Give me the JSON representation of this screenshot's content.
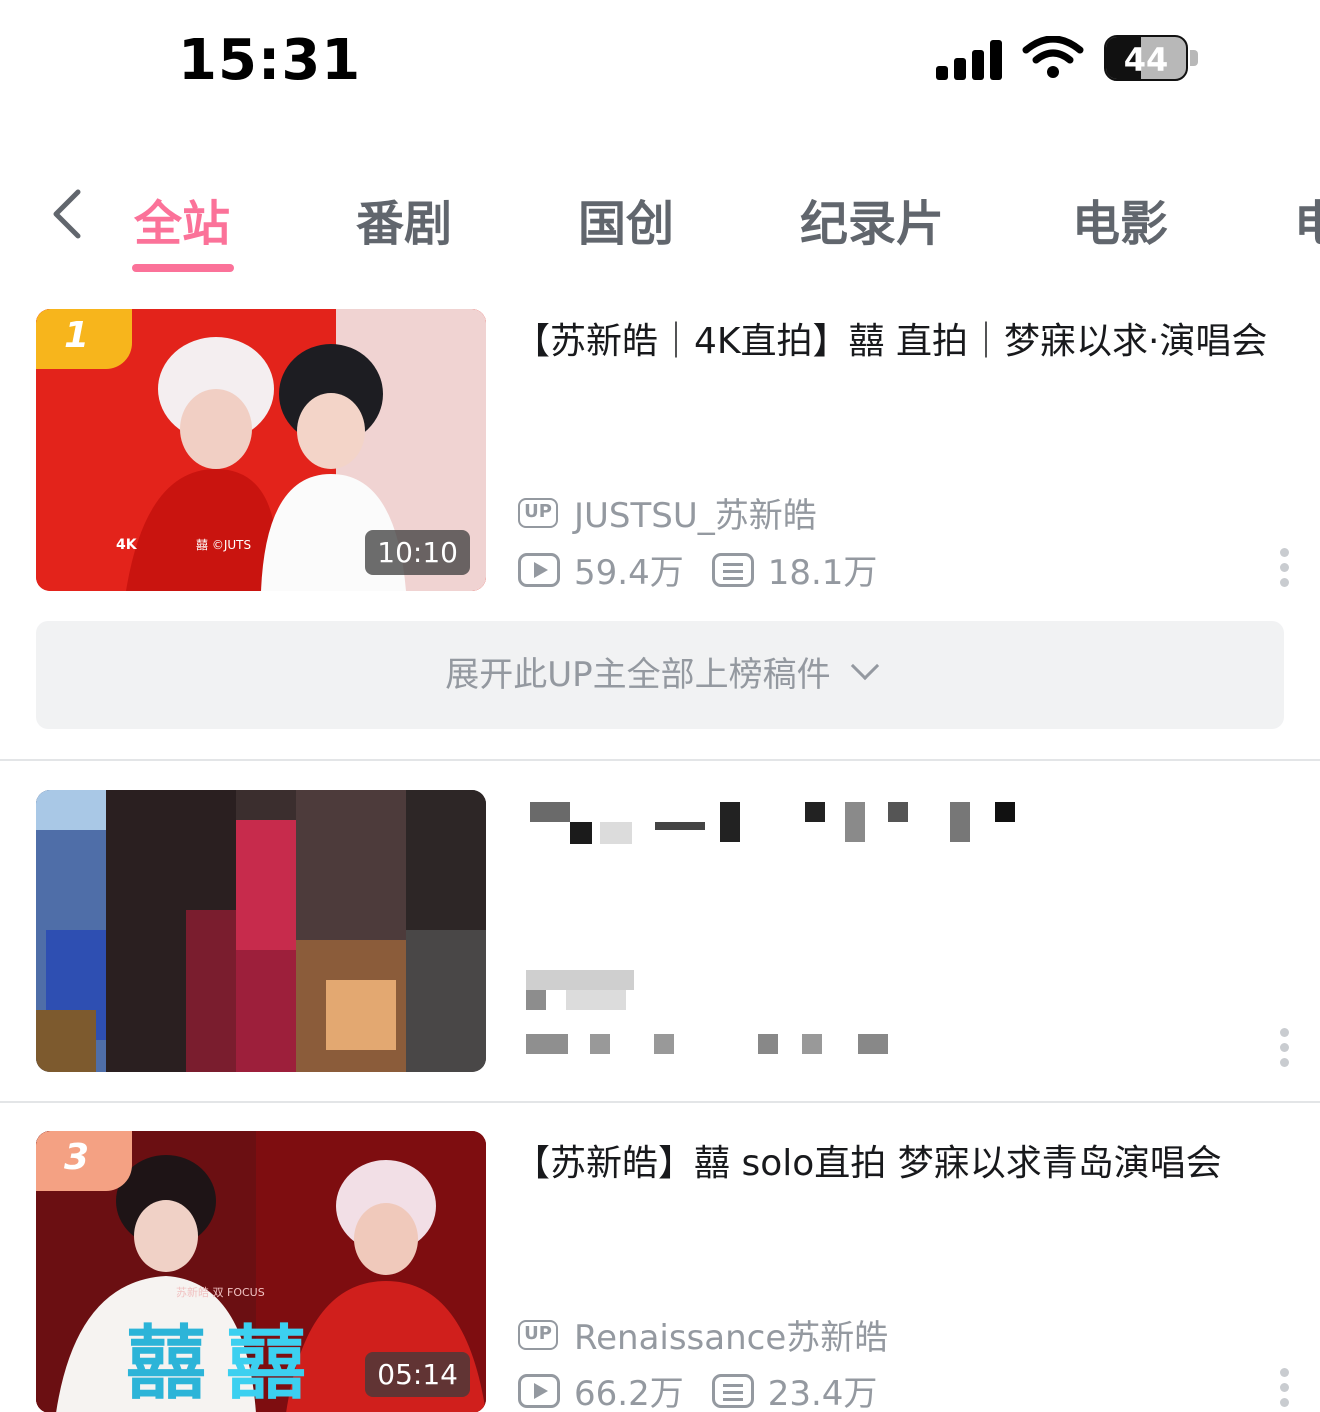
{
  "status_bar": {
    "time": "15:31",
    "battery": "44",
    "battery_level": 0.44
  },
  "tabs": [
    {
      "label": "全站",
      "active": true
    },
    {
      "label": "番剧",
      "active": false
    },
    {
      "label": "国创",
      "active": false
    },
    {
      "label": "纪录片",
      "active": false
    },
    {
      "label": "电影",
      "active": false
    },
    {
      "label": "电",
      "active": false
    }
  ],
  "videos": [
    {
      "rank": "1",
      "rank_color": "#f7b51c",
      "duration": "10:10",
      "title": "【苏新皓｜4K直拍】囍 直拍｜梦寐以求·演唱会",
      "up_icon": "UP",
      "uploader": "JUSTSU_苏新皓",
      "views": "59.4万",
      "danmaku": "18.1万"
    },
    {
      "rank": "3",
      "rank_color": "#f4a183",
      "duration": "05:14",
      "title": "【苏新皓】囍 solo直拍 梦寐以求青岛演唱会",
      "up_icon": "UP",
      "uploader": "Renaissance苏新皓",
      "views": "66.2万",
      "danmaku": "23.4万"
    }
  ],
  "expand_label": "展开此UP主全部上榜稿件",
  "colors": {
    "accent": "#fb7299",
    "meta": "#9499a0"
  },
  "icons": [
    "back-arrow-icon",
    "up-icon",
    "play-count-icon",
    "danmaku-count-icon",
    "more-icon",
    "chevron-down-icon"
  ]
}
